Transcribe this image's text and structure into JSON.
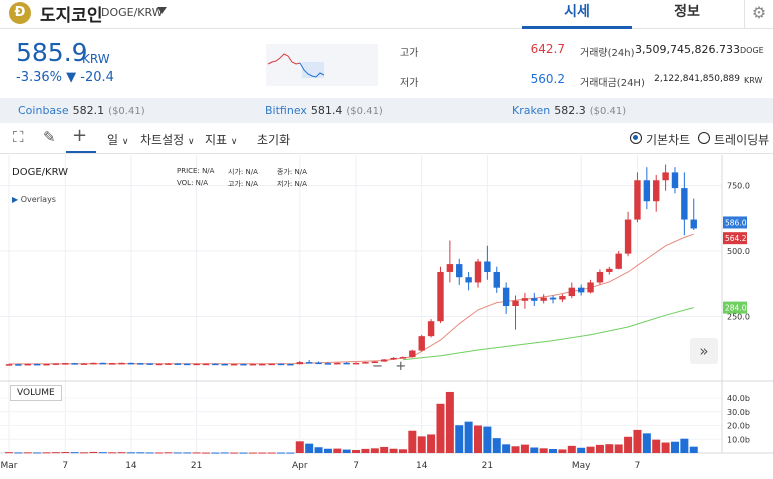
{
  "header": {
    "logo_letter": "Ð",
    "coin_name": "도지코인",
    "pair": "DOGE/KRW",
    "tabs": [
      {
        "label": "시세"
      },
      {
        "label": "정보"
      }
    ],
    "gear": "⚙"
  },
  "price": {
    "current": "585.9",
    "unit": "KRW",
    "change": "-3.36% ▼ -20.4"
  },
  "stats": {
    "high_label": "고가",
    "high": "642.7",
    "low_label": "저가",
    "low": "560.2",
    "volume_label": "거래량(24h)",
    "volume": "3,509,745,826.733",
    "volume_unit": "DOGE",
    "amount_label": "거래대금(24H)",
    "amount": "2,122,841,850,889",
    "amount_unit": "KRW"
  },
  "exchanges": [
    {
      "name": "Coinbase",
      "price": "582.1",
      "usd": "($0.41)"
    },
    {
      "name": "Bitfinex",
      "price": "581.4",
      "usd": "($0.41)"
    },
    {
      "name": "Kraken",
      "price": "582.3",
      "usd": "($0.41)"
    }
  ],
  "toolbar": {
    "period": "일",
    "chart_settings": "차트설정",
    "indicators": "지표",
    "reset": "초기화",
    "basic_chart": "기본차트",
    "tradingview": "트레이딩뷰"
  },
  "chart_labels": {
    "pair": "DOGE/KRW",
    "overlays": "Overlays",
    "volume": "VOLUME",
    "price_lbl": "PRICE:",
    "price_val": "N/A",
    "open_lbl": "시가:",
    "open_val": "N/A",
    "close_lbl": "종가:",
    "close_val": "N/A",
    "vol_lbl": "VOL:",
    "vol_val": "N/A",
    "high_lbl": "고가:",
    "high_val": "N/A",
    "low_lbl": "저가:",
    "low_val": "N/A"
  },
  "colors": {
    "up": "#d83a3f",
    "down": "#1f6fd6",
    "accent": "#1a5fb4",
    "ma_short": "#e8897d",
    "ma_long": "#6fcf5f"
  },
  "chart_data": {
    "type": "candlestick",
    "title": "DOGE/KRW",
    "y_ticks": [
      250,
      500,
      750
    ],
    "y_tick_labels": [
      "250.0",
      "500.0",
      "750.0"
    ],
    "volume_ticks": [
      "10.0b",
      "20.0b",
      "30.0b",
      "40.0b"
    ],
    "volume_tick_values": [
      10,
      20,
      30,
      40
    ],
    "x_labels": [
      "Mar",
      "7",
      "14",
      "21",
      "Apr",
      "7",
      "14",
      "21",
      "May",
      "7"
    ],
    "x_label_days": [
      0,
      6,
      13,
      20,
      31,
      37,
      44,
      51,
      61,
      67
    ],
    "markers": [
      {
        "label": "586.0",
        "value": 586.0,
        "color": "#2f79d8"
      },
      {
        "label": "564.2",
        "value": 564.2,
        "color": "#d83a3f"
      },
      {
        "label": "284.0",
        "value": 284.0,
        "color": "#6fcf5f"
      }
    ],
    "candles": [
      [
        0,
        68,
        69,
        67,
        68,
        0.6
      ],
      [
        1,
        68,
        69,
        66,
        67,
        0.4
      ],
      [
        2,
        67,
        70,
        66,
        69,
        0.5
      ],
      [
        3,
        69,
        70,
        67,
        68,
        0.4
      ],
      [
        4,
        68,
        70,
        67,
        69,
        0.5
      ],
      [
        5,
        69,
        72,
        68,
        71,
        0.6
      ],
      [
        6,
        71,
        73,
        70,
        72,
        0.7
      ],
      [
        7,
        72,
        73,
        69,
        70,
        0.6
      ],
      [
        8,
        70,
        72,
        69,
        71,
        0.5
      ],
      [
        9,
        71,
        74,
        70,
        73,
        0.8
      ],
      [
        10,
        73,
        74,
        70,
        71,
        0.6
      ],
      [
        11,
        71,
        73,
        70,
        72,
        0.5
      ],
      [
        12,
        72,
        74,
        71,
        73,
        0.6
      ],
      [
        13,
        73,
        74,
        71,
        72,
        0.5
      ],
      [
        14,
        72,
        73,
        70,
        71,
        0.5
      ],
      [
        15,
        71,
        72,
        69,
        70,
        0.4
      ],
      [
        16,
        70,
        71,
        68,
        70,
        0.4
      ],
      [
        17,
        70,
        72,
        69,
        71,
        0.5
      ],
      [
        18,
        71,
        72,
        69,
        70,
        0.4
      ],
      [
        19,
        70,
        71,
        68,
        69,
        0.4
      ],
      [
        20,
        69,
        71,
        68,
        70,
        0.4
      ],
      [
        21,
        70,
        71,
        69,
        70,
        0.3
      ],
      [
        22,
        70,
        71,
        68,
        69,
        0.3
      ],
      [
        23,
        69,
        70,
        67,
        68,
        0.4
      ],
      [
        24,
        68,
        70,
        67,
        69,
        0.3
      ],
      [
        25,
        69,
        70,
        67,
        68,
        0.3
      ],
      [
        26,
        68,
        70,
        67,
        69,
        0.3
      ],
      [
        27,
        69,
        70,
        68,
        69,
        0.3
      ],
      [
        28,
        69,
        71,
        68,
        70,
        0.3
      ],
      [
        29,
        70,
        71,
        68,
        69,
        0.3
      ],
      [
        30,
        69,
        70,
        67,
        68,
        0.3
      ],
      [
        31,
        68,
        80,
        67,
        76,
        8.5
      ],
      [
        32,
        76,
        84,
        72,
        74,
        6.8
      ],
      [
        33,
        74,
        78,
        70,
        72,
        4.2
      ],
      [
        34,
        72,
        75,
        69,
        70,
        3.1
      ],
      [
        35,
        70,
        74,
        68,
        73,
        3.2
      ],
      [
        36,
        73,
        76,
        71,
        72,
        2.5
      ],
      [
        37,
        72,
        75,
        70,
        73,
        2.2
      ],
      [
        38,
        73,
        77,
        72,
        76,
        3.0
      ],
      [
        39,
        76,
        80,
        74,
        78,
        3.4
      ],
      [
        40,
        78,
        88,
        77,
        86,
        4.4
      ],
      [
        41,
        86,
        95,
        84,
        92,
        3.1
      ],
      [
        42,
        92,
        98,
        89,
        95,
        2.7
      ],
      [
        43,
        95,
        123,
        93,
        120,
        16.2
      ],
      [
        44,
        120,
        180,
        116,
        175,
        12.1
      ],
      [
        45,
        175,
        240,
        170,
        232,
        13.5
      ],
      [
        46,
        232,
        440,
        225,
        420,
        35.8
      ],
      [
        47,
        420,
        540,
        380,
        450,
        44.4
      ],
      [
        48,
        450,
        470,
        370,
        400,
        20.2
      ],
      [
        49,
        400,
        420,
        350,
        380,
        22.8
      ],
      [
        50,
        380,
        470,
        360,
        460,
        20.0
      ],
      [
        51,
        460,
        520,
        390,
        420,
        19.2
      ],
      [
        52,
        420,
        440,
        340,
        360,
        10.8
      ],
      [
        53,
        360,
        380,
        260,
        290,
        6.3
      ],
      [
        54,
        290,
        330,
        200,
        310,
        4.9
      ],
      [
        55,
        310,
        340,
        280,
        320,
        6.1
      ],
      [
        56,
        320,
        340,
        290,
        310,
        4.0
      ],
      [
        57,
        310,
        335,
        300,
        322,
        3.4
      ],
      [
        58,
        322,
        330,
        300,
        315,
        2.9
      ],
      [
        59,
        315,
        335,
        305,
        328,
        2.6
      ],
      [
        60,
        328,
        380,
        320,
        360,
        5.2
      ],
      [
        61,
        360,
        372,
        330,
        342,
        3.8
      ],
      [
        62,
        342,
        390,
        338,
        380,
        4.6
      ],
      [
        63,
        380,
        430,
        372,
        420,
        5.9
      ],
      [
        64,
        420,
        440,
        410,
        432,
        6.4
      ],
      [
        65,
        432,
        500,
        430,
        490,
        6.2
      ],
      [
        66,
        490,
        650,
        480,
        620,
        11.8
      ],
      [
        67,
        620,
        800,
        610,
        770,
        16.8
      ],
      [
        68,
        770,
        820,
        660,
        690,
        14.3
      ],
      [
        69,
        690,
        790,
        650,
        770,
        9.7
      ],
      [
        70,
        770,
        830,
        730,
        800,
        7.6
      ],
      [
        71,
        800,
        820,
        720,
        740,
        8.2
      ],
      [
        72,
        740,
        800,
        560,
        620,
        10.4
      ],
      [
        73,
        620,
        700,
        580,
        586,
        4.6
      ]
    ],
    "ma_short": [
      [
        0,
        69
      ],
      [
        10,
        70
      ],
      [
        20,
        70
      ],
      [
        30,
        70
      ],
      [
        40,
        82
      ],
      [
        43,
        96
      ],
      [
        46,
        160
      ],
      [
        48,
        222
      ],
      [
        50,
        275
      ],
      [
        52,
        303
      ],
      [
        54,
        312
      ],
      [
        56,
        320
      ],
      [
        58,
        330
      ],
      [
        60,
        345
      ],
      [
        62,
        360
      ],
      [
        64,
        382
      ],
      [
        66,
        420
      ],
      [
        68,
        470
      ],
      [
        70,
        520
      ],
      [
        72,
        552
      ],
      [
        73,
        564
      ]
    ],
    "ma_long": [
      [
        42,
        85
      ],
      [
        46,
        100
      ],
      [
        50,
        122
      ],
      [
        54,
        140
      ],
      [
        58,
        158
      ],
      [
        62,
        180
      ],
      [
        66,
        210
      ],
      [
        70,
        255
      ],
      [
        73,
        284
      ]
    ]
  }
}
